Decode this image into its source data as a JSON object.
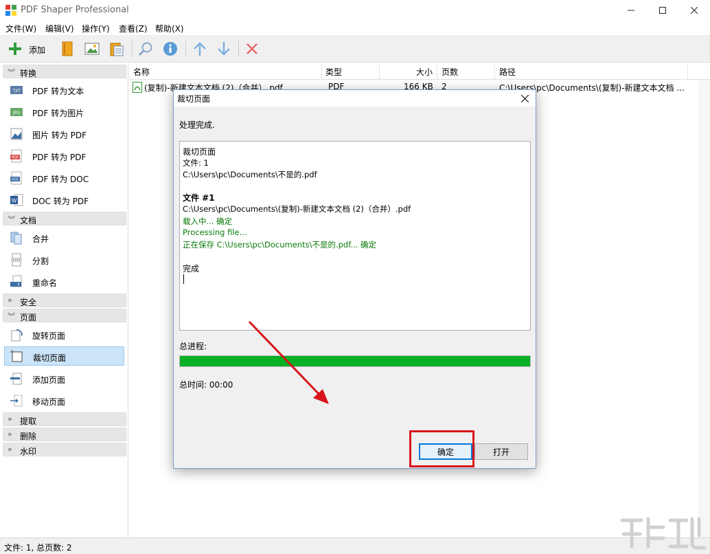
{
  "window": {
    "title": "PDF Shaper Professional"
  },
  "menubar": {
    "items": [
      "文件(W)",
      "编辑(V)",
      "操作(Y)",
      "查看(Z)",
      "帮助(X)"
    ]
  },
  "toolbar": {
    "add_label": "添加"
  },
  "sidebar": {
    "sections": {
      "convert": "转换",
      "document": "文档",
      "security": "安全",
      "pages": "页面",
      "extract": "提取",
      "delete": "删除",
      "watermark": "水印"
    },
    "convert_items": [
      "PDF 转为文本",
      "PDF 转为图片",
      "图片 转为 PDF",
      "PDF 转为 PDF",
      "PDF 转为 DOC",
      "DOC 转为 PDF"
    ],
    "document_items": [
      "合并",
      "分割",
      "重命名"
    ],
    "page_items": [
      "旋转页面",
      "裁切页面",
      "添加页面",
      "移动页面"
    ]
  },
  "filelist": {
    "columns": [
      "名称",
      "类型",
      "大小",
      "页数",
      "路径"
    ],
    "rows": [
      {
        "name": "(复制)-新建文本文档 (2)（合并）.pdf",
        "type": "PDF",
        "size": "166 KB",
        "pages": "2",
        "path": "C:\\Users\\pc\\Documents\\(复制)-新建文本文档 ..."
      }
    ]
  },
  "dialog": {
    "title": "裁切页面",
    "status": "处理完成.",
    "log": {
      "l1": "裁切页面",
      "l2": "文件: 1",
      "l3": "C:\\Users\\pc\\Documents\\不是的.pdf",
      "l4": "文件 #1",
      "l5": "C:\\Users\\pc\\Documents\\(复制)-新建文本文档 (2)（合并）.pdf",
      "l6": "载入中... 确定",
      "l7": "Processing file...",
      "l8": "正在保存 C:\\Users\\pc\\Documents\\不是的.pdf... 确定",
      "l9": "完成"
    },
    "progress_label": "总进程:",
    "progress_value": 1.0,
    "total_time": "总时间: 00:00",
    "ok_label": "确定",
    "open_label": "打开"
  },
  "statusbar": {
    "text": "文件: 1, 总页数: 2"
  },
  "colors": {
    "progress": "#06b025",
    "highlight": "#d7141a",
    "selection": "#cce4f7"
  }
}
